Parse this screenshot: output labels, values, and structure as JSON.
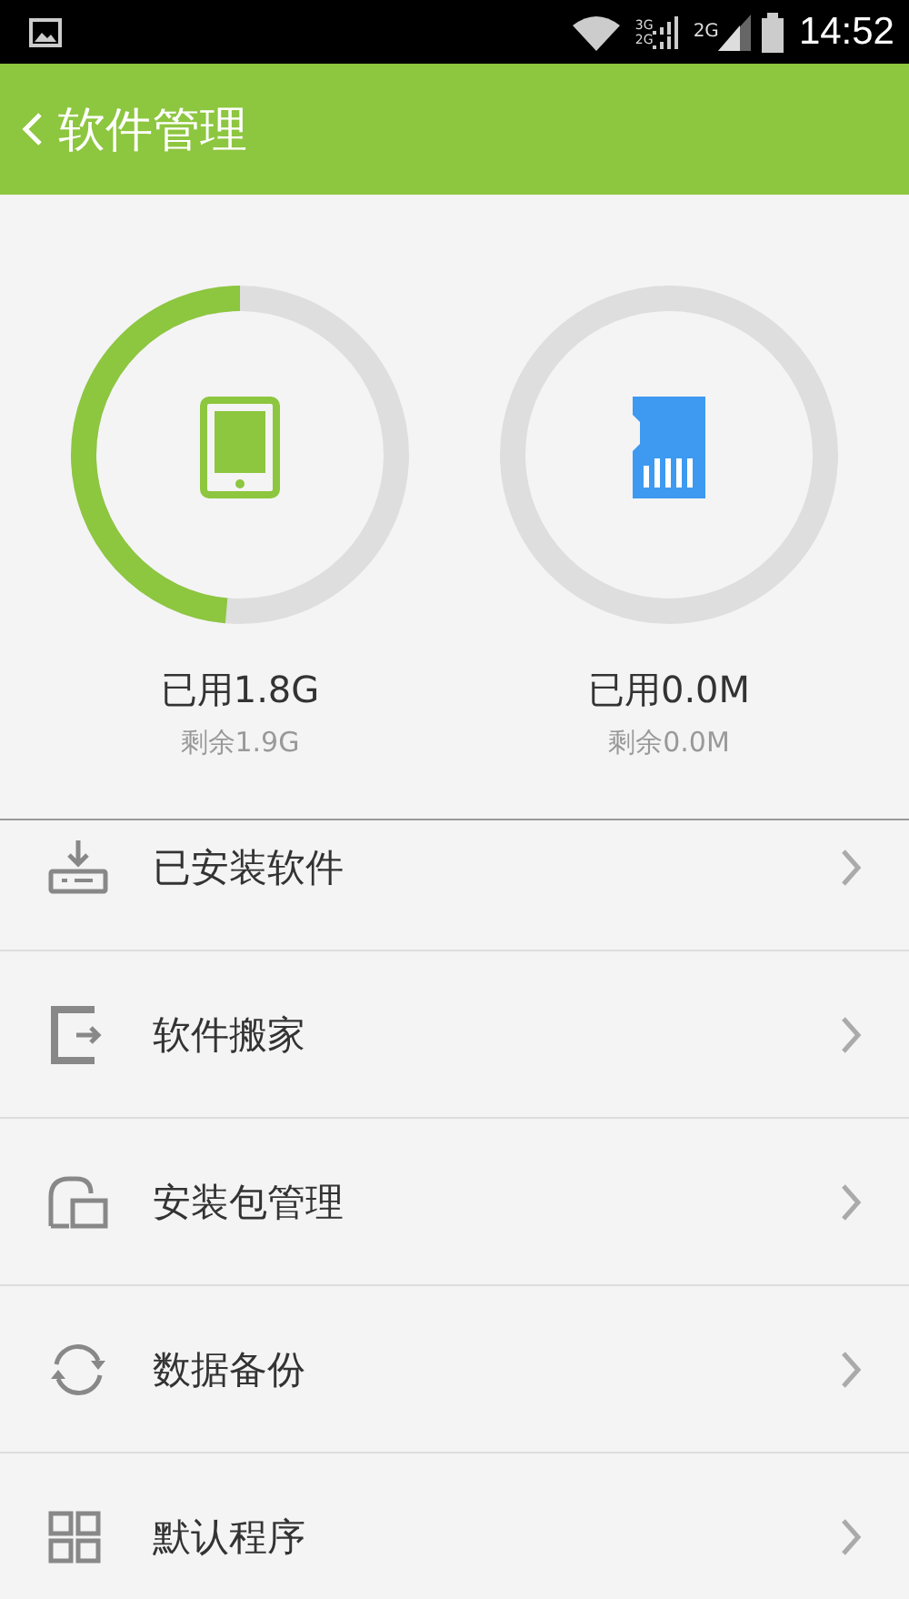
{
  "status_bar": {
    "network_labels": [
      "3G",
      "2G",
      "2G"
    ],
    "time": "14:52"
  },
  "header": {
    "title": "软件管理"
  },
  "storage": [
    {
      "kind": "phone",
      "used": "已用1.8G",
      "free": "剩余1.9G"
    },
    {
      "kind": "sd",
      "used": "已用0.0M",
      "free": "剩余0.0M"
    }
  ],
  "menu": [
    {
      "kind": "installed",
      "label": "已安装软件"
    },
    {
      "kind": "move",
      "label": "软件搬家"
    },
    {
      "kind": "package",
      "label": "安装包管理"
    },
    {
      "kind": "backup",
      "label": "数据备份"
    },
    {
      "kind": "default",
      "label": "默认程序"
    }
  ]
}
